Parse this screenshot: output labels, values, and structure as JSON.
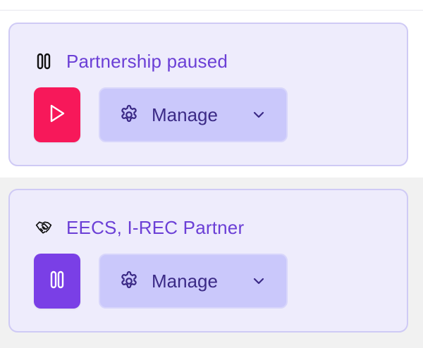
{
  "partners": [
    {
      "status_icon": "pause-icon",
      "status_label": "Partnership paused",
      "toggle_icon": "play-icon",
      "toggle_color": "#f7185a",
      "manage_label": "Manage",
      "manage_icon": "gear-icon",
      "manage_dropdown_icon": "chevron-down-icon"
    },
    {
      "status_icon": "handshake-icon",
      "status_label": "EECS, I-REC Partner",
      "toggle_icon": "pause-icon",
      "toggle_color": "#7a3fe6",
      "manage_label": "Manage",
      "manage_icon": "gear-icon",
      "manage_dropdown_icon": "chevron-down-icon"
    }
  ],
  "colors": {
    "accent_text": "#6b3fd6",
    "card_background": "#eeecfc",
    "card_border": "#cfcaf5",
    "manage_background": "#cac8fb",
    "manage_text": "#3b2a86"
  }
}
